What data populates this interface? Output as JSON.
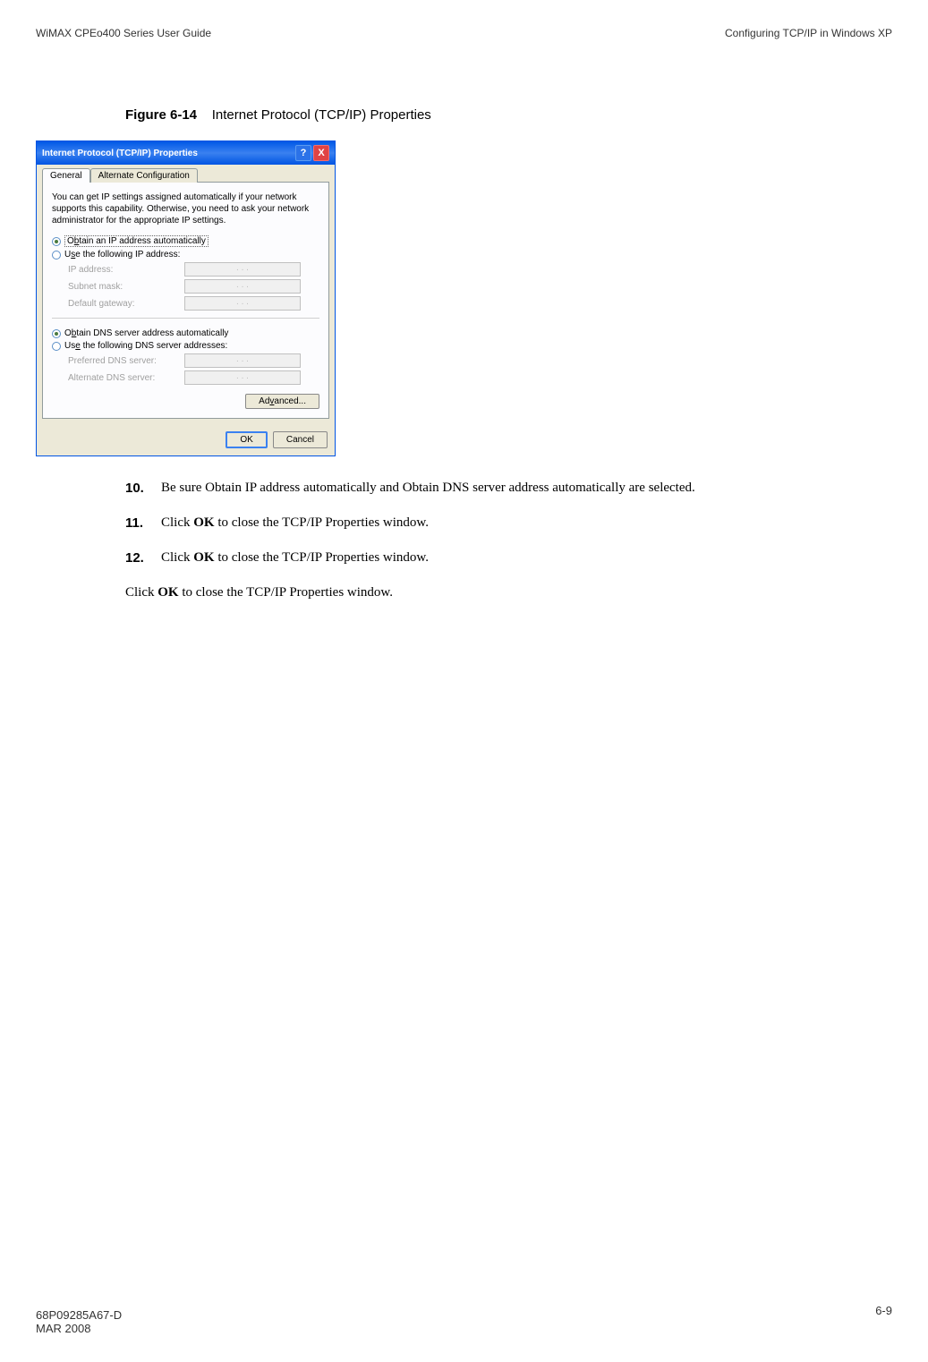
{
  "header": {
    "left": "WiMAX CPEo400 Series User Guide",
    "right": "Configuring TCP/IP in Windows XP"
  },
  "figure": {
    "number": "Figure 6-14",
    "title": "Internet Protocol (TCP/IP) Properties"
  },
  "dialog": {
    "title": "Internet Protocol (TCP/IP) Properties",
    "tabs": {
      "general": "General",
      "alternate": "Alternate Configuration"
    },
    "intro": "You can get IP settings assigned automatically if your network supports this capability. Otherwise, you need to ask your network administrator for the appropriate IP settings.",
    "radio": {
      "obtain_ip_prefix": "O",
      "obtain_ip_underline": "b",
      "obtain_ip_suffix": "tain an IP address automatically",
      "use_ip_prefix": "U",
      "use_ip_underline": "s",
      "use_ip_suffix": "e the following IP address:",
      "obtain_dns_prefix": "O",
      "obtain_dns_underline": "b",
      "obtain_dns_suffix": "tain DNS server address automatically",
      "use_dns_prefix": "Us",
      "use_dns_underline": "e",
      "use_dns_suffix": " the following DNS server addresses:"
    },
    "fields": {
      "ip_address": "IP address:",
      "subnet_mask": "Subnet mask:",
      "gateway": "Default gateway:",
      "preferred_dns": "Preferred DNS server:",
      "alternate_dns": "Alternate DNS server:"
    },
    "dots": ".   .   .",
    "buttons": {
      "advanced_prefix": "Ad",
      "advanced_underline": "v",
      "advanced_suffix": "anced...",
      "ok": "OK",
      "cancel": "Cancel"
    }
  },
  "steps": [
    {
      "num": "10.",
      "text": "Be sure Obtain IP address automatically and Obtain DNS server address automatically are selected."
    },
    {
      "num": "11.",
      "prefix": "Click ",
      "bold": "OK",
      "suffix": " to close the TCP/IP Properties window."
    },
    {
      "num": "12.",
      "prefix": "Click ",
      "bold": "OK",
      "suffix": " to close the TCP/IP Properties window."
    }
  ],
  "final": {
    "prefix": "Click ",
    "bold": "OK",
    "suffix": " to close the TCP/IP Properties window."
  },
  "footer": {
    "doc_num": "68P09285A67-D",
    "date": "MAR 2008",
    "page": "6-9"
  }
}
